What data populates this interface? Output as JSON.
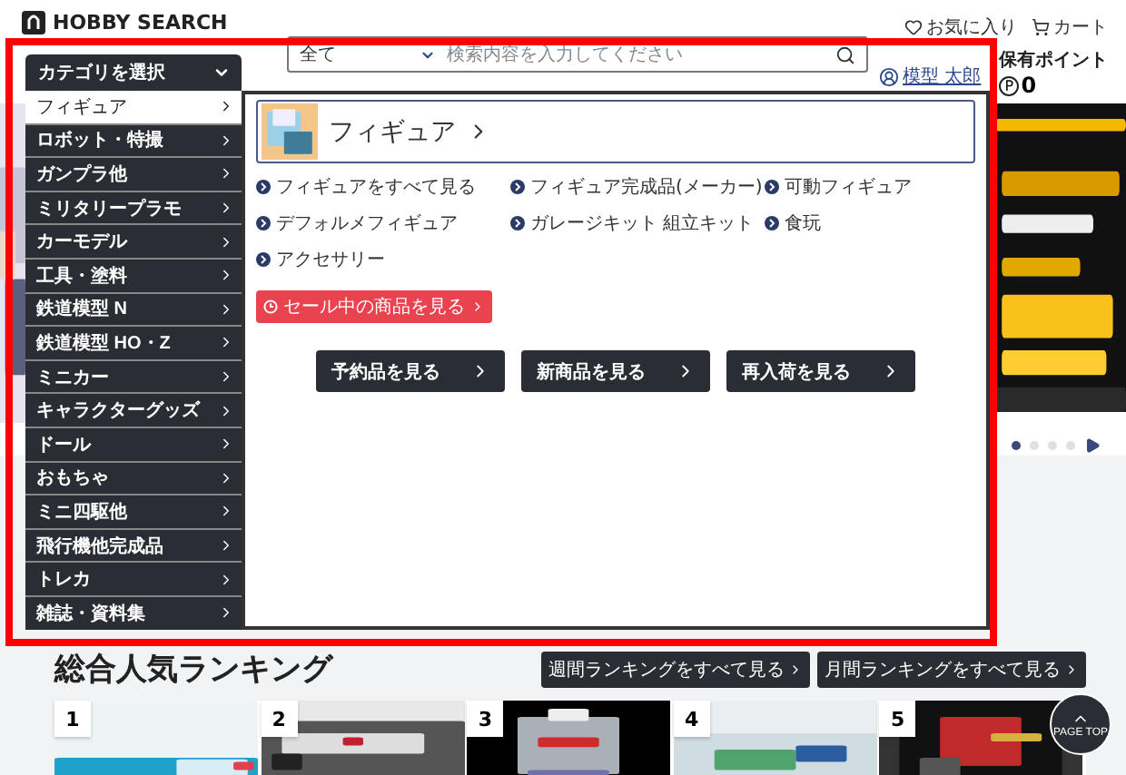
{
  "header": {
    "logo": "HOBBY SEARCH",
    "favorites": "お気に入り",
    "cart": "カート",
    "search": {
      "scope": "全て",
      "placeholder": "検索内容を入力してください"
    },
    "user": "模型 太郎",
    "points_label": "保有ポイント",
    "points_mark": "P",
    "points": "0"
  },
  "category_menu": {
    "title": "カテゴリを選択",
    "expanded": true,
    "items": [
      {
        "label": "フィギュア",
        "selected": true
      },
      {
        "label": "ロボット・特撮",
        "selected": false
      },
      {
        "label": "ガンプラ他",
        "selected": false
      },
      {
        "label": "ミリタリープラモ",
        "selected": false
      },
      {
        "label": "カーモデル",
        "selected": false
      },
      {
        "label": "工具・塗料",
        "selected": false
      },
      {
        "label": "鉄道模型 N",
        "selected": false
      },
      {
        "label": "鉄道模型 HO・Z",
        "selected": false
      },
      {
        "label": "ミニカー",
        "selected": false
      },
      {
        "label": "キャラクターグッズ",
        "selected": false
      },
      {
        "label": "ドール",
        "selected": false
      },
      {
        "label": "おもちゃ",
        "selected": false
      },
      {
        "label": "ミニ四駆他",
        "selected": false
      },
      {
        "label": "飛行機他完成品",
        "selected": false
      },
      {
        "label": "トレカ",
        "selected": false
      },
      {
        "label": "雑誌・資料集",
        "selected": false
      }
    ]
  },
  "panel": {
    "heading": "フィギュア",
    "links": [
      "フィギュアをすべて見る",
      "フィギュア完成品(メーカー)",
      "可動フィギュア",
      "デフォルメフィギュア",
      "ガレージキット 組立キット",
      "食玩",
      "アクセサリー"
    ],
    "sale": "セール中の商品を見る",
    "buttons": [
      "予約品を見る",
      "新商品を見る",
      "再入荷を見る"
    ]
  },
  "carousel": {
    "dots": [
      {
        "selected": true
      },
      {
        "selected": false
      },
      {
        "selected": false
      },
      {
        "selected": false
      }
    ]
  },
  "ranking": {
    "title": "総合人気ランキング",
    "buttons": [
      "週間ランキングをすべて見る",
      "月間ランキングをすべて見る"
    ],
    "items": [
      {
        "rank": "1"
      },
      {
        "rank": "2"
      },
      {
        "rank": "3"
      },
      {
        "rank": "4"
      },
      {
        "rank": "5"
      }
    ]
  },
  "page_top": "PAGE TOP"
}
